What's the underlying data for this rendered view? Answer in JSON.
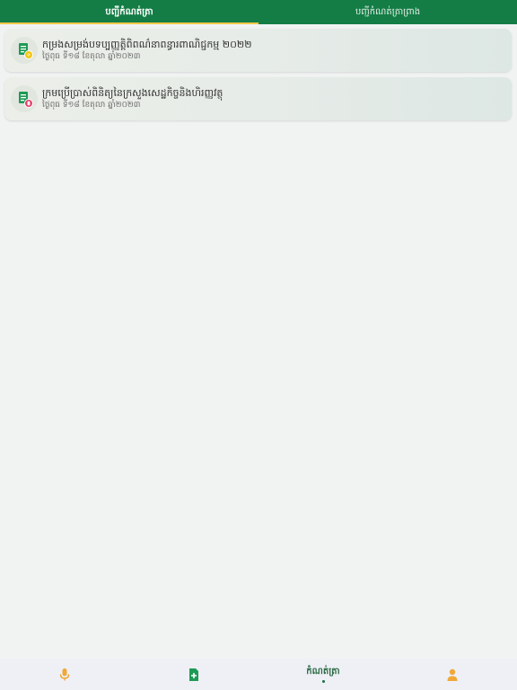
{
  "tabs": [
    {
      "label": "បញ្ជីកំណត់ត្រា",
      "active": true
    },
    {
      "label": "បញ្ជីកំណត់ត្រាព្រាង",
      "active": false
    }
  ],
  "records": [
    {
      "title": "កម្រងសម្រង់បទប្បញ្ញត្តិពិពណ៌នាពន្ធារពាណិជ្ជកម្ម ២០២២",
      "date": "ថ្ងៃពុធ ទី១៨ ខែតុលា ឆ្នាំ២០២៣",
      "badge_icon": "yellow-badge-icon",
      "badge_color": "#f1c40f"
    },
    {
      "title": "ក្រមប្រើប្រាស់ពិនិត្យនៃក្រសួងសេដ្ឋកិច្ចនិងហិរញ្ញវត្ថុ",
      "date": "ថ្ងៃពុធ ទី១៨ ខែតុលា ឆ្នាំ២០២៣",
      "badge_icon": "red-badge-icon",
      "badge_color": "#e0406a"
    }
  ],
  "bottom_nav": [
    {
      "icon": "microphone-icon",
      "label": ""
    },
    {
      "icon": "add-document-icon",
      "label": ""
    },
    {
      "icon": "",
      "label": "កំណត់ត្រា",
      "active": true
    },
    {
      "icon": "profile-icon",
      "label": ""
    }
  ],
  "colors": {
    "primary": "#137d45",
    "tab_indicator": "#f0c84a",
    "icon_orange": "#f0a838",
    "icon_green": "#1e9a56"
  }
}
